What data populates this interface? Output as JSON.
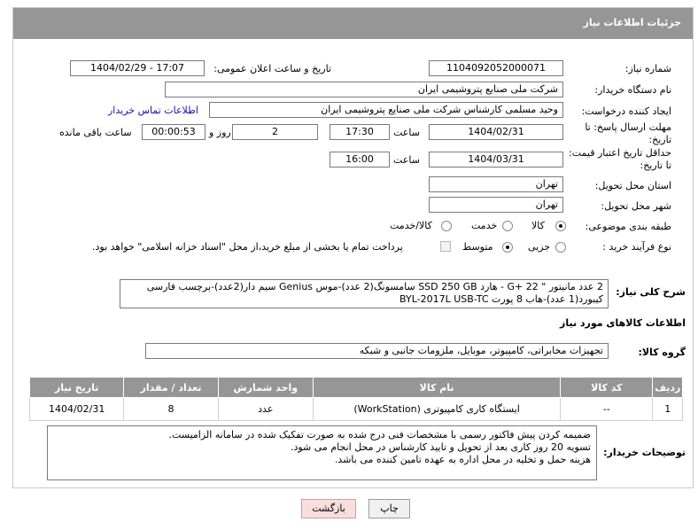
{
  "header": {
    "title": "جزئیات اطلاعات نیاز"
  },
  "fields": {
    "need_number_label": "شماره نیاز:",
    "need_number": "1104092052000071",
    "announce_label": "تاریخ و ساعت اعلان عمومی:",
    "announce_value": "1404/02/29 - 17:07",
    "buyer_org_label": "نام دستگاه خریدار:",
    "buyer_org": "شرکت ملی صنایع پتروشیمی ایران",
    "creator_label": "ایجاد کننده درخواست:",
    "creator": "وحید مسلمی کارشناس شرکت ملی صنایع پتروشیمی ایران",
    "contact_link": "اطلاعات تماس خریدار",
    "deadline_label": "مهلت ارسال پاسخ: تا تاریخ:",
    "deadline_date": "1404/02/31",
    "time_label": "ساعت",
    "deadline_time": "17:30",
    "days_value": "2",
    "days_label": "روز و",
    "remaining_value": "00:00:53",
    "remaining_label": "ساعت باقی مانده",
    "validity_label": "حداقل تاریخ اعتبار قیمت: تا تاریخ:",
    "validity_date": "1404/03/31",
    "validity_time": "16:00",
    "province_label": "استان محل تحویل:",
    "province": "تهران",
    "city_label": "شهر محل تحویل:",
    "city": "تهران",
    "category_label": "طبقه بندی موضوعی:",
    "category_options": [
      "کالا",
      "خدمت",
      "کالا/خدمت"
    ],
    "process_label": "نوع فرآیند خرید :",
    "process_options": [
      "جزیی",
      "متوسط"
    ],
    "payment_note": "پرداخت تمام یا بخشی از مبلغ خرید،از محل \"اسناد خزانه اسلامی\" خواهد بود."
  },
  "description": {
    "label": "شرح کلی نیاز:",
    "line1": "2 عدد مانیتور \" 22 +G - هارد SSD 250 GB سامسونگ(2 عدد)-موس Genius سیم دار(2عدد)-برچسب فارسی",
    "line2": "کیبورد(1 عدد)-هاب 8 پورت BYL-2017L USB-TC"
  },
  "goods_section": {
    "title": "اطلاعات کالاهای مورد نیاز",
    "group_label": "گروه کالا:",
    "group_value": "تجهیزات مخابراتی، کامپیوتر، موبایل، ملزومات جانبی و شبکه"
  },
  "table": {
    "headers": [
      "ردیف",
      "کد کالا",
      "نام کالا",
      "واحد شمارش",
      "تعداد / مقدار",
      "تاریخ نیاز"
    ],
    "rows": [
      [
        "1",
        "--",
        "ایستگاه کاری کامپیوتری (WorkStation)",
        "عدد",
        "8",
        "1404/02/31"
      ]
    ]
  },
  "buyer_notes": {
    "label": "توضیحات خریدار:",
    "line1": "ضمیمه کردن پیش فاکتور رسمی با مشخصات فنی درج شده  به صورت تفکیک شده در سامانه الزامیست.",
    "line2": "تسویه 20 روز کاری بعد از تحویل و تایید  کارشناس در محل انجام می شود.",
    "line3": "هزینه حمل و تخلیه در محل اداره به عهده تامین کننده می باشد."
  },
  "buttons": {
    "print": "چاپ",
    "back": "بازگشت"
  },
  "colors": {
    "header_bg": "#969696",
    "link": "#1a0dab",
    "back_button_bg": "#f9dede"
  }
}
